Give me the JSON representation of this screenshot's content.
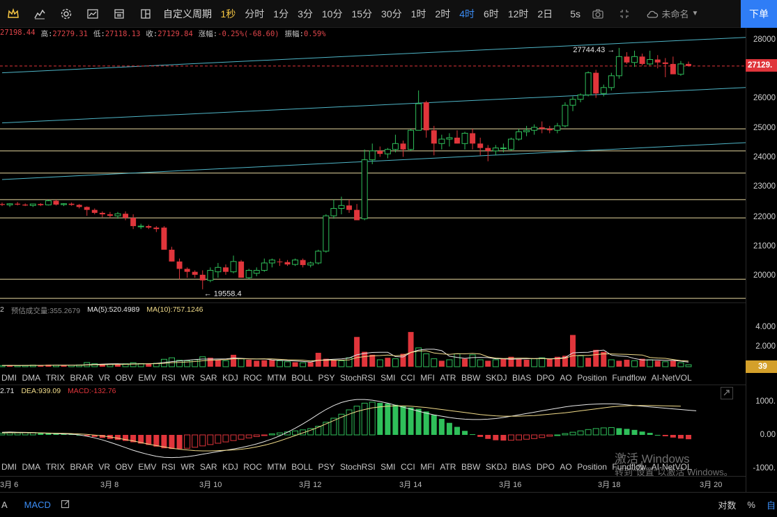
{
  "toolbar": {
    "custom_period": "自定义周期",
    "periods": [
      "1秒",
      "分时",
      "1分",
      "3分",
      "10分",
      "15分",
      "30分",
      "1时",
      "2时",
      "4时",
      "6时",
      "12时",
      "2日"
    ],
    "active_period_yellow": "1秒",
    "active_period_blue": "4时",
    "refresh": "5s",
    "layout_name": "未命名",
    "order_button": "下单"
  },
  "ohlc": {
    "open": "27198.44",
    "high_label": "高:",
    "high": "27279.31",
    "low_label": "低:",
    "low": "27118.13",
    "close_label": "收:",
    "close": "27129.84",
    "change_label": "涨幅:",
    "change": "-0.25%(-68.60)",
    "amplitude_label": "振幅:",
    "amplitude": "0.59%"
  },
  "price_axis": {
    "labels": [
      "28000",
      "26000",
      "25000",
      "24000",
      "23000",
      "22000",
      "21000",
      "20000"
    ],
    "current_price": "27129.",
    "max_annotation": "27744.43 →",
    "min_annotation": "← 19558.4"
  },
  "volume_panel": {
    "legend_prefix": "2",
    "estimated_label": "预估成交量:",
    "estimated_value": "355.2679",
    "ma5": "MA(5):520.4989",
    "ma10": "MA(10):757.1246",
    "axis_labels": [
      "4.000",
      "2.000"
    ],
    "current": "39"
  },
  "indicator_tabs": [
    "DMI",
    "DMA",
    "TRIX",
    "BRAR",
    "VR",
    "OBV",
    "EMV",
    "RSI",
    "WR",
    "SAR",
    "KDJ",
    "ROC",
    "MTM",
    "BOLL",
    "PSY",
    "StochRSI",
    "SMI",
    "CCI",
    "MFI",
    "ATR",
    "BBW",
    "SKDJ",
    "BIAS",
    "DPO",
    "AO",
    "Position",
    "Fundflow",
    "AI-NetVOL"
  ],
  "macd_panel": {
    "dif": "2.71",
    "dea": "DEA:939.09",
    "macd": "MACD:-132.76",
    "axis_labels": [
      "1000.",
      "0.00",
      "-1000."
    ]
  },
  "date_axis": [
    "3月 6",
    "3月 8",
    "3月 10",
    "3月 12",
    "3月 14",
    "3月 16",
    "3月 18",
    "3月 20"
  ],
  "bottom_bar": {
    "left_icon": "A",
    "indicator": "MACD",
    "log_scale": "对数",
    "percent": "%",
    "auto": "自"
  },
  "watermark": {
    "line1": "激活 Windows",
    "line2": "转到\"设置\"以激活 Windows。"
  },
  "colors": {
    "up": "#2fbf5a",
    "down": "#e0353b",
    "accent_blue": "#3b8df5",
    "accent_yellow": "#f5c542"
  },
  "chart_data": {
    "type": "candlestick",
    "series_ohlc": [
      [
        22450,
        22500,
        22380,
        22420
      ],
      [
        22420,
        22480,
        22350,
        22460
      ],
      [
        22460,
        22520,
        22400,
        22430
      ],
      [
        22430,
        22470,
        22380,
        22400
      ],
      [
        22400,
        22460,
        22350,
        22450
      ],
      [
        22450,
        22480,
        22380,
        22410
      ],
      [
        22420,
        22600,
        22400,
        22560
      ],
      [
        22560,
        22600,
        22400,
        22430
      ],
      [
        22430,
        22480,
        22380,
        22460
      ],
      [
        22460,
        22500,
        22390,
        22420
      ],
      [
        22420,
        22450,
        22300,
        22350
      ],
      [
        22350,
        22370,
        22050,
        22250
      ],
      [
        22250,
        22300,
        22100,
        22150
      ],
      [
        22150,
        22200,
        22000,
        22100
      ],
      [
        22100,
        22180,
        21980,
        22050
      ],
      [
        22050,
        22180,
        21950,
        22120
      ],
      [
        22120,
        22200,
        21900,
        21980
      ],
      [
        21980,
        22100,
        21600,
        21700
      ],
      [
        21700,
        21780,
        21600,
        21700
      ],
      [
        21700,
        21750,
        21600,
        21650
      ],
      [
        21650,
        21700,
        21500,
        21600
      ],
      [
        21650,
        21700,
        21000,
        20900
      ],
      [
        20900,
        21000,
        20500,
        20500
      ],
      [
        20500,
        20600,
        19900,
        20250
      ],
      [
        20250,
        20300,
        19950,
        20150
      ],
      [
        20150,
        20200,
        19950,
        20050
      ],
      [
        20050,
        20200,
        19558,
        19860
      ],
      [
        19860,
        20300,
        19800,
        20200
      ],
      [
        20150,
        20450,
        19950,
        20300
      ],
      [
        20300,
        20400,
        20050,
        20150
      ],
      [
        20150,
        20700,
        20100,
        20500
      ],
      [
        20500,
        20550,
        19950,
        19950
      ],
      [
        19950,
        20250,
        19900,
        20200
      ],
      [
        20100,
        20300,
        20000,
        20200
      ],
      [
        20200,
        20600,
        20150,
        20450
      ],
      [
        20450,
        20600,
        20300,
        20550
      ],
      [
        20500,
        20600,
        20350,
        20480
      ],
      [
        20480,
        20550,
        20350,
        20400
      ],
      [
        20400,
        20600,
        20350,
        20550
      ],
      [
        20550,
        20600,
        20300,
        20380
      ],
      [
        20380,
        20500,
        20300,
        20450
      ],
      [
        20450,
        20900,
        20400,
        20850
      ],
      [
        20850,
        22100,
        20800,
        22050
      ],
      [
        22050,
        22600,
        21950,
        22300
      ],
      [
        22300,
        22700,
        22100,
        22400
      ],
      [
        22400,
        22600,
        22150,
        22250
      ],
      [
        22250,
        22450,
        21900,
        21900
      ],
      [
        21950,
        24300,
        21900,
        23950
      ],
      [
        23950,
        24500,
        23800,
        24250
      ],
      [
        24250,
        24400,
        24050,
        24150
      ],
      [
        24150,
        24350,
        24000,
        24300
      ],
      [
        24300,
        24800,
        24200,
        24500
      ],
      [
        24500,
        24600,
        24050,
        24300
      ],
      [
        24300,
        25000,
        24250,
        24950
      ],
      [
        24950,
        26300,
        24950,
        25850
      ],
      [
        25900,
        25950,
        24700,
        24950
      ],
      [
        24950,
        25100,
        24100,
        24500
      ],
      [
        24500,
        24800,
        24300,
        24650
      ],
      [
        24650,
        24850,
        24400,
        24700
      ],
      [
        24700,
        24950,
        24500,
        24500
      ],
      [
        24500,
        24900,
        24300,
        24850
      ],
      [
        24850,
        25000,
        24300,
        24500
      ],
      [
        24500,
        24700,
        24100,
        24350
      ],
      [
        24350,
        24450,
        23900,
        24250
      ],
      [
        24250,
        24450,
        24100,
        24350
      ],
      [
        24350,
        24500,
        24200,
        24350
      ],
      [
        24300,
        24700,
        24250,
        24650
      ],
      [
        24650,
        25000,
        24600,
        24900
      ],
      [
        24900,
        25100,
        24750,
        24950
      ],
      [
        24950,
        25150,
        24800,
        25050
      ],
      [
        25050,
        25250,
        24850,
        25000
      ],
      [
        25000,
        25100,
        24850,
        24950
      ],
      [
        24950,
        25200,
        24850,
        25100
      ],
      [
        25100,
        25900,
        25050,
        25800
      ],
      [
        25800,
        26100,
        25600,
        26000
      ],
      [
        26000,
        26200,
        25900,
        26150
      ],
      [
        26150,
        26950,
        26100,
        26900
      ],
      [
        26900,
        27000,
        26050,
        26200
      ],
      [
        26200,
        26500,
        26100,
        26400
      ],
      [
        26400,
        26900,
        26300,
        26800
      ],
      [
        26800,
        27744,
        26700,
        27450
      ],
      [
        27450,
        27600,
        27200,
        27250
      ],
      [
        27250,
        27650,
        27100,
        27450
      ],
      [
        27450,
        27550,
        27150,
        27200
      ],
      [
        27200,
        27650,
        27150,
        27350
      ],
      [
        27350,
        27500,
        27050,
        27250
      ],
      [
        27250,
        27400,
        26750,
        27200
      ],
      [
        27200,
        27450,
        26900,
        26850
      ],
      [
        26850,
        27300,
        26800,
        27200
      ],
      [
        27200,
        27280,
        27118,
        27130
      ]
    ],
    "volumes": [
      [
        120,
        1
      ],
      [
        140,
        0
      ],
      [
        110,
        1
      ],
      [
        130,
        1
      ],
      [
        160,
        1
      ],
      [
        140,
        0
      ],
      [
        200,
        0
      ],
      [
        150,
        1
      ],
      [
        130,
        0
      ],
      [
        140,
        1
      ],
      [
        180,
        1
      ],
      [
        420,
        1
      ],
      [
        300,
        1
      ],
      [
        250,
        0
      ],
      [
        280,
        1
      ],
      [
        220,
        0
      ],
      [
        300,
        1
      ],
      [
        400,
        1
      ],
      [
        320,
        1
      ],
      [
        280,
        0
      ],
      [
        350,
        1
      ],
      [
        750,
        1
      ],
      [
        900,
        1
      ],
      [
        650,
        1
      ],
      [
        600,
        1
      ],
      [
        700,
        1
      ],
      [
        1000,
        1
      ],
      [
        900,
        0
      ],
      [
        700,
        0
      ],
      [
        600,
        1
      ],
      [
        1200,
        0
      ],
      [
        800,
        1
      ],
      [
        700,
        0
      ],
      [
        600,
        0
      ],
      [
        650,
        0
      ],
      [
        700,
        0
      ],
      [
        600,
        1
      ],
      [
        500,
        1
      ],
      [
        450,
        0
      ],
      [
        400,
        1
      ],
      [
        450,
        0
      ],
      [
        1400,
        0
      ],
      [
        800,
        0
      ],
      [
        700,
        0
      ],
      [
        600,
        1
      ],
      [
        900,
        1
      ],
      [
        3000,
        0
      ],
      [
        1500,
        0
      ],
      [
        1200,
        0
      ],
      [
        700,
        1
      ],
      [
        900,
        0
      ],
      [
        800,
        1
      ],
      [
        1300,
        0
      ],
      [
        3500,
        0
      ],
      [
        1900,
        1
      ],
      [
        1300,
        1
      ],
      [
        800,
        1
      ],
      [
        600,
        0
      ],
      [
        700,
        1
      ],
      [
        1300,
        1
      ],
      [
        800,
        0
      ],
      [
        1200,
        1
      ],
      [
        700,
        1
      ],
      [
        600,
        0
      ],
      [
        700,
        1
      ],
      [
        800,
        0
      ],
      [
        1000,
        0
      ],
      [
        800,
        0
      ],
      [
        700,
        0
      ],
      [
        800,
        1
      ],
      [
        900,
        1
      ],
      [
        800,
        0
      ],
      [
        1000,
        0
      ],
      [
        1100,
        0
      ],
      [
        3200,
        0
      ],
      [
        1100,
        1
      ],
      [
        900,
        0
      ],
      [
        1700,
        0
      ],
      [
        1500,
        0
      ],
      [
        700,
        1
      ],
      [
        600,
        0
      ],
      [
        700,
        0
      ],
      [
        600,
        1
      ],
      [
        800,
        0
      ],
      [
        700,
        1
      ],
      [
        600,
        0
      ],
      [
        500,
        1
      ],
      [
        600,
        0
      ],
      [
        400,
        1
      ],
      [
        200,
        1
      ]
    ],
    "xlabels": [
      "3月 6",
      "3月 8",
      "3月 10",
      "3月 12",
      "3月 14",
      "3月 16",
      "3月 18",
      "3月 20"
    ],
    "ylim": [
      19300,
      28200
    ],
    "horizontal_levels": [
      25000,
      24250,
      23500,
      22600,
      21980,
      19900,
      19250
    ],
    "trendlines": [
      {
        "from": [
          0,
          26900
        ],
        "to": [
          90,
          28100
        ]
      },
      {
        "from": [
          0,
          25200
        ],
        "to": [
          90,
          26400
        ]
      },
      {
        "from": [
          0,
          23280
        ],
        "to": [
          90,
          24530
        ]
      }
    ],
    "macd_hist": [
      50,
      60,
      60,
      70,
      70,
      60,
      50,
      40,
      30,
      20,
      0,
      -30,
      -60,
      -90,
      -120,
      -150,
      -180,
      -220,
      -260,
      -300,
      -350,
      -400,
      -420,
      -420,
      -400,
      -370,
      -330,
      -290,
      -250,
      -210,
      -170,
      -130,
      -90,
      -50,
      -10,
      30,
      60,
      90,
      120,
      150,
      190,
      260,
      380,
      500,
      620,
      750,
      860,
      950,
      980,
      960,
      940,
      900,
      860,
      820,
      780,
      700,
      600,
      480,
      360,
      240,
      120,
      20,
      -60,
      -120,
      -160,
      -170,
      -160,
      -150,
      -130,
      -110,
      -80,
      -40,
      0,
      40,
      80,
      120,
      160,
      190,
      210,
      220,
      200,
      180,
      150,
      100,
      60,
      0,
      -40,
      -80,
      -110,
      -130
    ],
    "macd_dif": [
      80,
      85,
      80,
      75,
      70,
      60,
      50,
      40,
      30,
      20,
      0,
      -40,
      -90,
      -150,
      -220,
      -300,
      -380,
      -460,
      -530,
      -590,
      -640,
      -670,
      -680,
      -670,
      -650,
      -620,
      -580,
      -540,
      -500,
      -460,
      -420,
      -380,
      -330,
      -270,
      -200,
      -120,
      -30,
      80,
      200,
      330,
      470,
      620,
      760,
      880,
      970,
      1030,
      1060,
      1060,
      1040,
      1000,
      950,
      890,
      830,
      770,
      710,
      650,
      600,
      560,
      520,
      490,
      470,
      460,
      460,
      470,
      490,
      520,
      560,
      600,
      640,
      680,
      720,
      760,
      800,
      840,
      870,
      890,
      910,
      920,
      930,
      930,
      920,
      900,
      880,
      860,
      840,
      820,
      800,
      780,
      760,
      740,
      720
    ],
    "macd_dea": [
      60,
      65,
      65,
      65,
      62,
      60,
      55,
      50,
      45,
      40,
      30,
      15,
      -5,
      -30,
      -60,
      -100,
      -140,
      -180,
      -230,
      -280,
      -320,
      -360,
      -400,
      -430,
      -450,
      -470,
      -480,
      -480,
      -470,
      -460,
      -450,
      -430,
      -400,
      -360,
      -310,
      -250,
      -180,
      -100,
      -20,
      60,
      140,
      230,
      330,
      430,
      530,
      620,
      700,
      760,
      810,
      840,
      860,
      870,
      870,
      860,
      840,
      820,
      790,
      760,
      730,
      700,
      670,
      640,
      610,
      590,
      570,
      560,
      560,
      560,
      570,
      580,
      600,
      620,
      640,
      660,
      690,
      720,
      750,
      780,
      810,
      840,
      860,
      870,
      880,
      880,
      880,
      875,
      870,
      865,
      860
    ]
  }
}
